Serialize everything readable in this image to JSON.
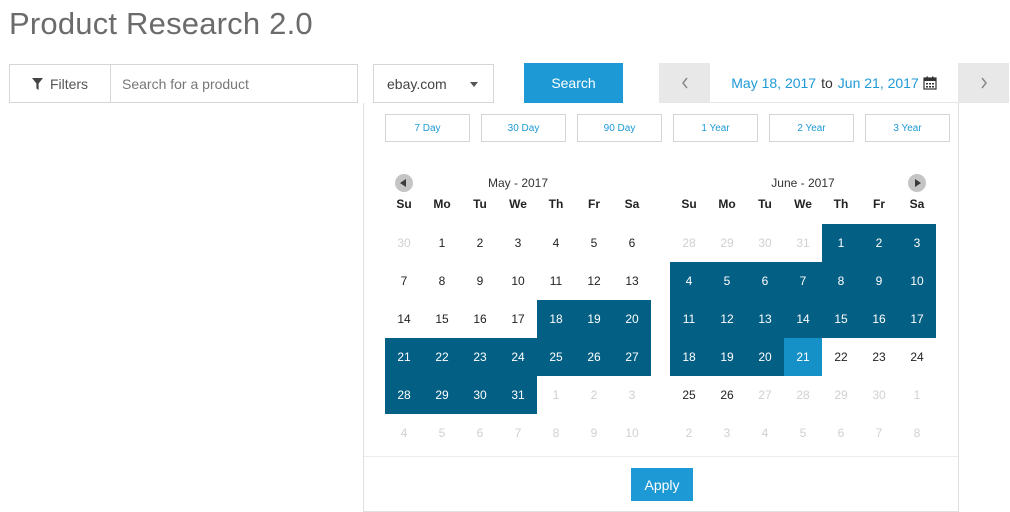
{
  "page": {
    "title": "Product Research 2.0"
  },
  "toolbar": {
    "filters_label": "Filters",
    "search_placeholder": "Search for a product",
    "site_value": "ebay.com",
    "search_label": "Search"
  },
  "range": {
    "start": "May 18, 2017",
    "to": "to",
    "end": "Jun 21, 2017"
  },
  "presets": [
    "7 Day",
    "30 Day",
    "90 Day",
    "1 Year",
    "2 Year",
    "3 Year"
  ],
  "weekdays": [
    "Su",
    "Mo",
    "Tu",
    "We",
    "Th",
    "Fr",
    "Sa"
  ],
  "months": [
    {
      "label": "May - 2017",
      "weeks": [
        [
          "30",
          "1",
          "2",
          "3",
          "4",
          "5",
          "6"
        ],
        [
          "7",
          "8",
          "9",
          "10",
          "11",
          "12",
          "13"
        ],
        [
          "14",
          "15",
          "16",
          "17",
          "18",
          "19",
          "20"
        ],
        [
          "21",
          "22",
          "23",
          "24",
          "25",
          "26",
          "27"
        ],
        [
          "28",
          "29",
          "30",
          "31",
          "1",
          "2",
          "3"
        ],
        [
          "4",
          "5",
          "6",
          "7",
          "8",
          "9",
          "10"
        ]
      ],
      "states": [
        [
          "off",
          "",
          "",
          "",
          "",
          "",
          ""
        ],
        [
          "",
          "",
          "",
          "",
          "",
          "",
          ""
        ],
        [
          "",
          "",
          "",
          "",
          "in",
          "in",
          "in"
        ],
        [
          "in",
          "in",
          "in",
          "in",
          "in",
          "in",
          "in"
        ],
        [
          "in",
          "in",
          "in",
          "in",
          "off",
          "off",
          "off"
        ],
        [
          "off",
          "off",
          "off",
          "off",
          "off",
          "off",
          "off"
        ]
      ]
    },
    {
      "label": "June - 2017",
      "weeks": [
        [
          "28",
          "29",
          "30",
          "31",
          "1",
          "2",
          "3"
        ],
        [
          "4",
          "5",
          "6",
          "7",
          "8",
          "9",
          "10"
        ],
        [
          "11",
          "12",
          "13",
          "14",
          "15",
          "16",
          "17"
        ],
        [
          "18",
          "19",
          "20",
          "21",
          "22",
          "23",
          "24"
        ],
        [
          "25",
          "26",
          "27",
          "28",
          "29",
          "30",
          "1"
        ],
        [
          "2",
          "3",
          "4",
          "5",
          "6",
          "7",
          "8"
        ]
      ],
      "states": [
        [
          "off",
          "off",
          "off",
          "off",
          "in",
          "in",
          "in"
        ],
        [
          "in",
          "in",
          "in",
          "in",
          "in",
          "in",
          "in"
        ],
        [
          "in",
          "in",
          "in",
          "in",
          "in",
          "in",
          "in"
        ],
        [
          "in",
          "in",
          "in",
          "end",
          "",
          "",
          ""
        ],
        [
          "",
          "",
          "off",
          "off",
          "off",
          "off",
          "off"
        ],
        [
          "off",
          "off",
          "off",
          "off",
          "off",
          "off",
          "off"
        ]
      ]
    }
  ],
  "apply_label": "Apply",
  "colors": {
    "accent": "#1d9ad6",
    "range": "#045f85",
    "range_end": "#1591c8"
  }
}
